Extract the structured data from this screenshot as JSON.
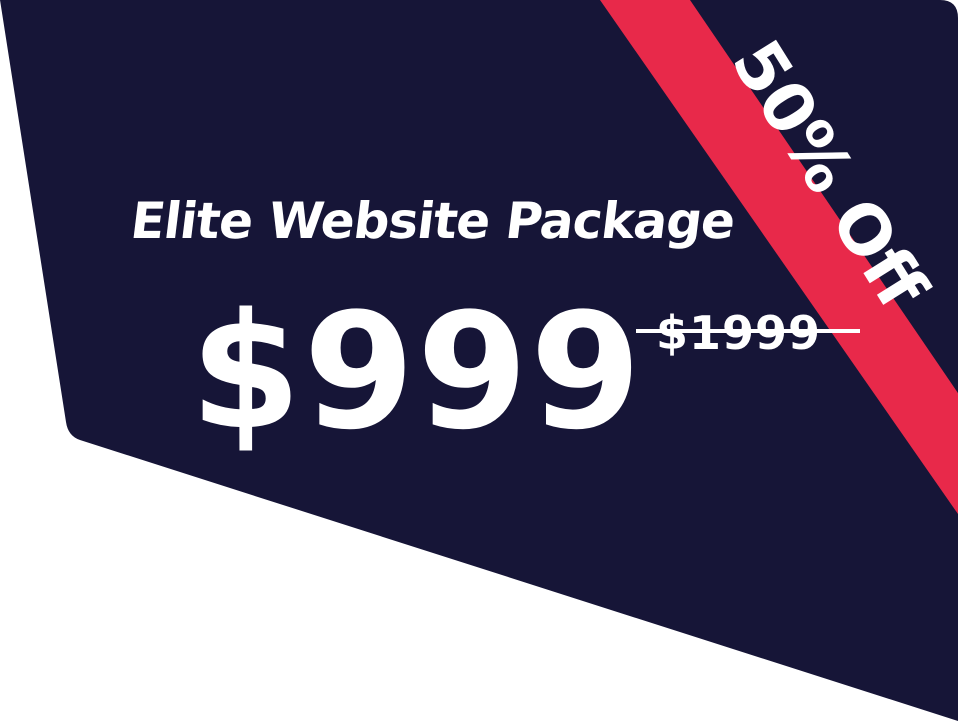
{
  "offer": {
    "title": "Elite Website Package",
    "price": "$999",
    "original_price": "$1999",
    "badge": "50% Off"
  },
  "colors": {
    "card_background": "#161537",
    "ribbon": "#e8294a",
    "text": "#ffffff",
    "page_background": "#ffffff"
  }
}
